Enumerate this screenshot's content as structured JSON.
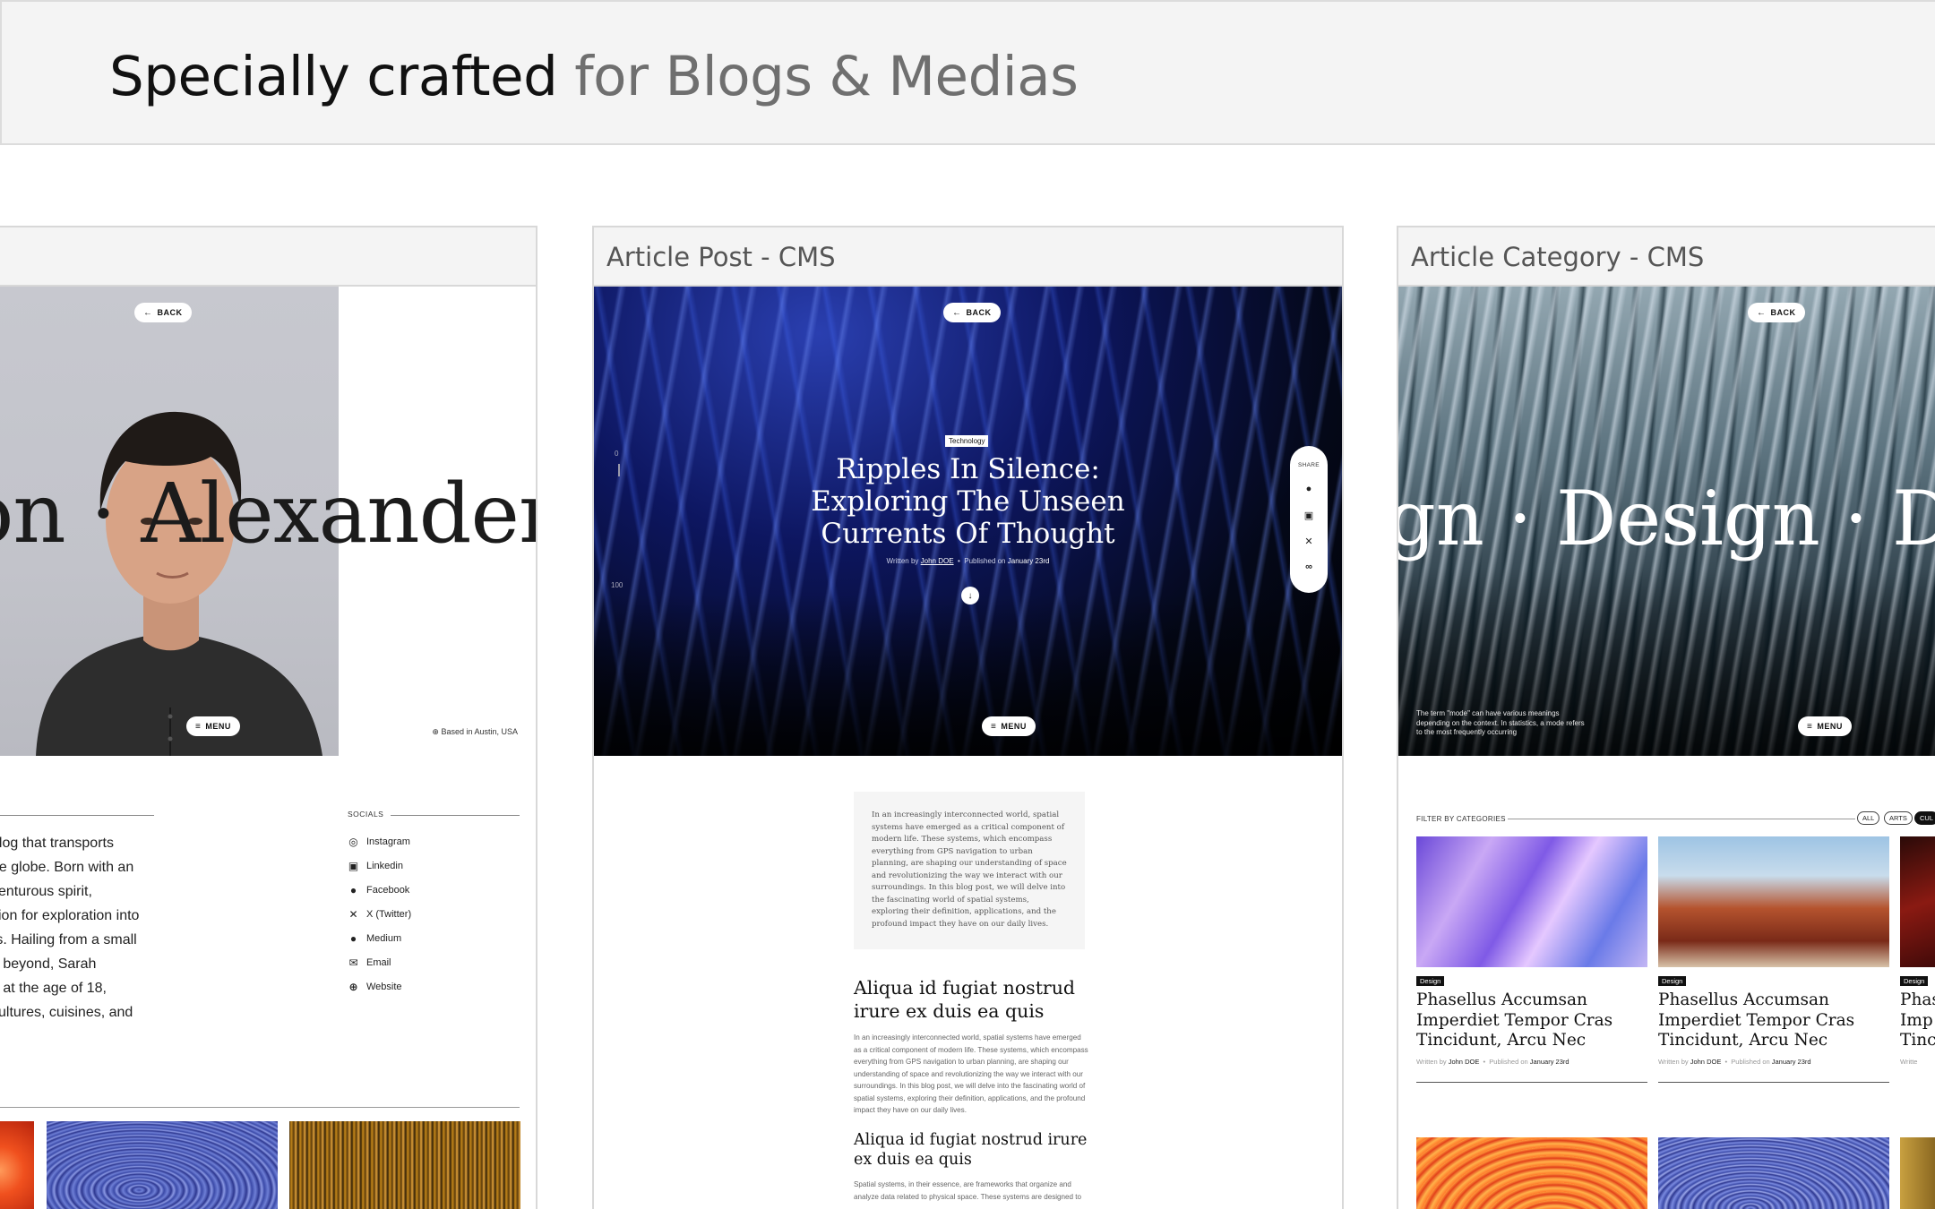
{
  "headline": {
    "dark": "Specially crafted",
    "light": "for Blogs & Medias"
  },
  "card1": {
    "title": "",
    "back_label": "BACK",
    "menu_label": "MENU",
    "name_text": "on · Alexander O",
    "based_in": "Based in Austin, USA",
    "bio_lines": [
      "blog that transports",
      "he globe. Born with an",
      "venturous spirit,",
      "sion for exploration into",
      "rs. Hailing from a small",
      "d beyond, Sarah",
      "e at the age of 18,",
      "cultures, cuisines, and"
    ],
    "socials_label": "SOCIALS",
    "socials": [
      {
        "label": "Instagram",
        "icon": "instagram-icon"
      },
      {
        "label": "Linkedin",
        "icon": "linkedin-icon"
      },
      {
        "label": "Facebook",
        "icon": "facebook-icon"
      },
      {
        "label": "X (Twitter)",
        "icon": "x-icon"
      },
      {
        "label": "Medium",
        "icon": "medium-icon"
      },
      {
        "label": "Email",
        "icon": "email-icon"
      },
      {
        "label": "Website",
        "icon": "globe-icon"
      }
    ]
  },
  "card2": {
    "title": "Article Post - CMS",
    "back_label": "BACK",
    "menu_label": "MENU",
    "tag": "Technology",
    "article_title": [
      "Ripples In Silence:",
      "Exploring The Unseen",
      "Currents Of Thought"
    ],
    "written_by_label": "Written by",
    "author": "John DOE",
    "published_label": "Published on",
    "date": "January 23rd",
    "scroll_top": "0",
    "scroll_bottom": "100",
    "share_label": "SHARE",
    "intro": "In an increasingly interconnected world, spatial systems have emerged as a critical component of modern life. These systems, which encompass everything from GPS navigation to urban planning, are shaping our understanding of space and revolutionizing the way we interact with our surroundings. In this blog post, we will delve into the fascinating world of spatial systems, exploring their definition, applications, and the profound impact they have on our daily lives.",
    "heading_1": "Aliqua id fugiat nostrud irure ex duis ea quis",
    "paragraph_1": "In an increasingly interconnected world, spatial systems have emerged as a critical component of modern life. These systems, which encompass everything from GPS navigation to urban planning, are shaping our understanding of space and revolutionizing the way we interact with our surroundings. In this blog post, we will delve into the fascinating world of spatial systems, exploring their definition, applications, and the profound impact they have on our daily lives.",
    "heading_2": "Aliqua id fugiat nostrud irure ex duis ea quis",
    "paragraph_2": "Spatial systems, in their essence, are frameworks that organize and analyze data related to physical space. These systems are designed to"
  },
  "card3": {
    "title": "Article Category - CMS",
    "back_label": "BACK",
    "menu_label": "MENU",
    "category_text": "gn · Design · Desi",
    "note": "The term \"mode\" can have various meanings depending on the context. In statistics, a mode refers to the most frequently occurring",
    "filter_label": "FILTER BY CATEGORIES",
    "chips": [
      "ALL",
      "ARTS",
      "CUL"
    ],
    "posts": [
      {
        "tag": "Design",
        "title": [
          "Phasellus Accumsan",
          "Imperdiet Tempor Cras",
          "Tincidunt, Arcu Nec"
        ],
        "written_by_label": "Written by",
        "author": "John DOE",
        "published_label": "Published on",
        "date": "January 23rd"
      },
      {
        "tag": "Design",
        "title": [
          "Phasellus Accumsan",
          "Imperdiet Tempor Cras",
          "Tincidunt, Arcu Nec"
        ],
        "written_by_label": "Written by",
        "author": "John DOE",
        "published_label": "Published on",
        "date": "January 23rd"
      },
      {
        "tag": "Design",
        "title": [
          "Phas",
          "Imp",
          "Tinc"
        ],
        "written_by_label": "Writte"
      }
    ]
  }
}
